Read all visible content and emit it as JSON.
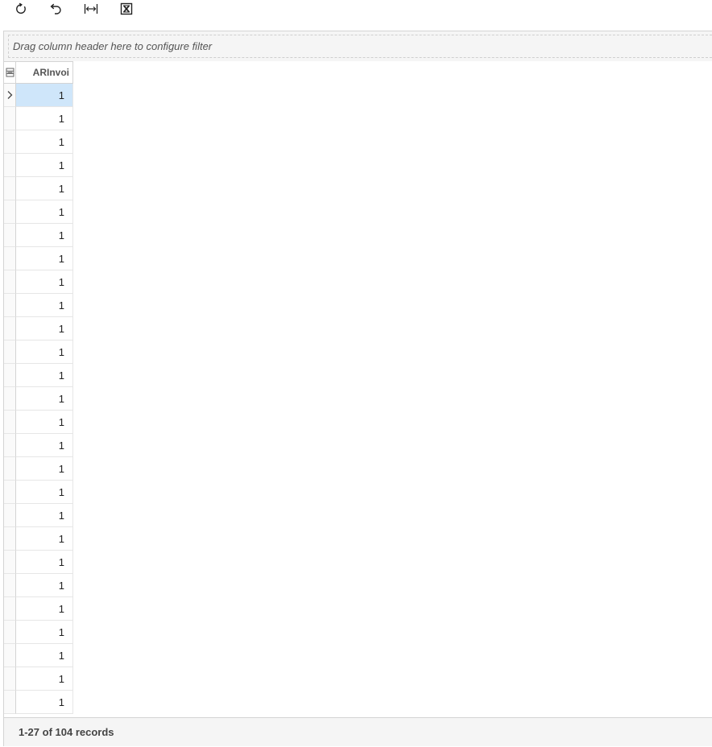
{
  "toolbar": {
    "buttons": [
      {
        "name": "refresh",
        "icon": "refresh-icon"
      },
      {
        "name": "undo",
        "icon": "undo-icon"
      },
      {
        "name": "fit-columns",
        "icon": "fit-columns-icon"
      },
      {
        "name": "export-excel",
        "icon": "excel-export-icon"
      }
    ]
  },
  "filter_bar": {
    "hint": "Drag column header here to configure filter"
  },
  "grid": {
    "selector_icon": "column-chooser-icon",
    "columns": [
      {
        "header": "ARInvoi"
      }
    ],
    "rows": [
      "1",
      "1",
      "1",
      "1",
      "1",
      "1",
      "1",
      "1",
      "1",
      "1",
      "1",
      "1",
      "1",
      "1",
      "1",
      "1",
      "1",
      "1",
      "1",
      "1",
      "1",
      "1",
      "1",
      "1",
      "1",
      "1",
      "1"
    ],
    "active_row": 0,
    "active_color": "#cfe6fa"
  },
  "footer": {
    "records_text": "1-27 of 104 records"
  }
}
